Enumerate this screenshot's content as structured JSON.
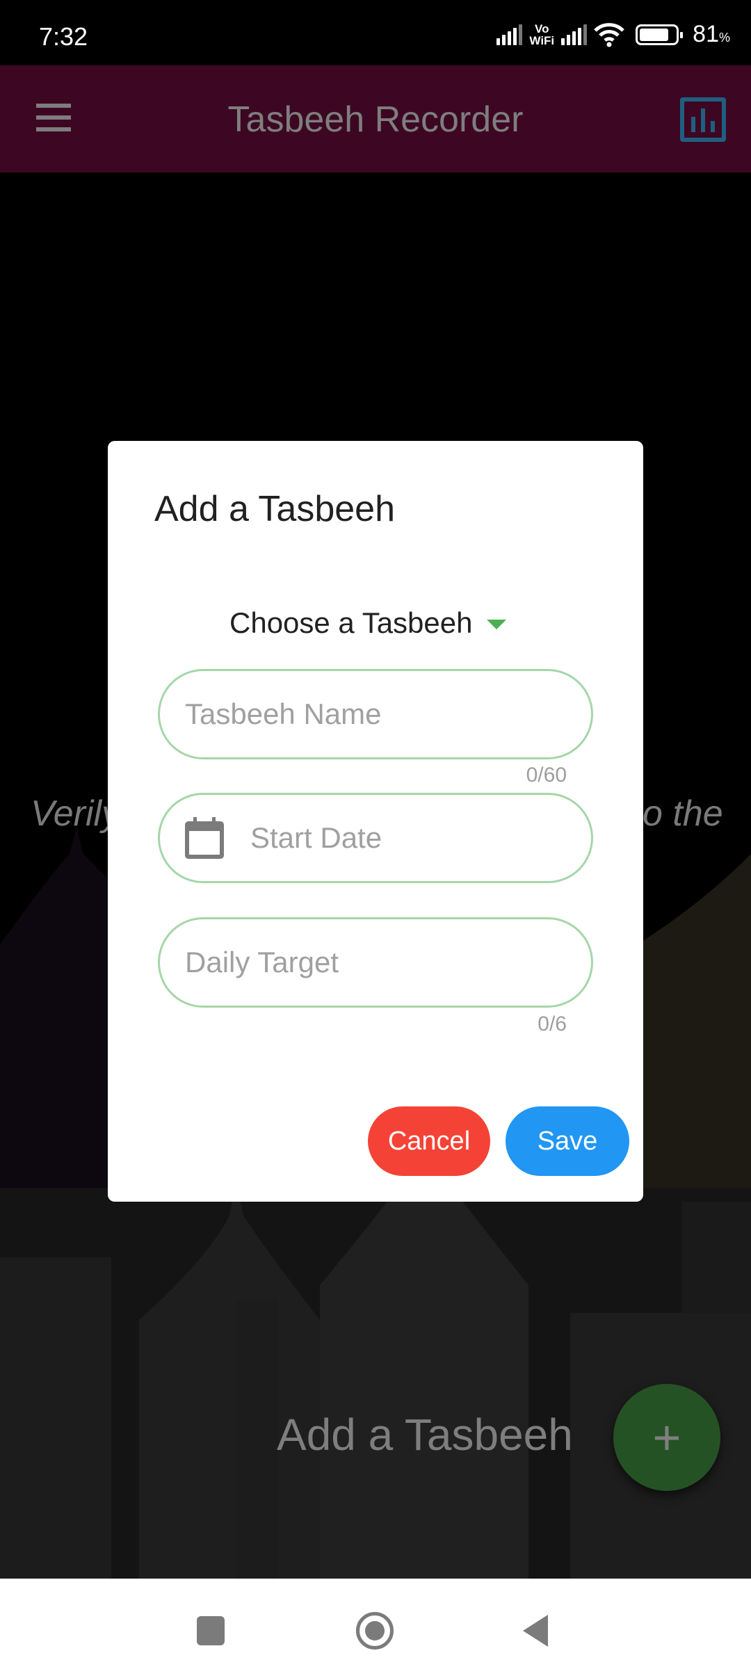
{
  "status_bar": {
    "time": "7:32",
    "vowifi_top": "Vo",
    "vowifi_bottom": "WiFi",
    "battery_percent": "81",
    "battery_percent_sign": "%",
    "battery_level": 0.81
  },
  "app_bar": {
    "title": "Tasbeeh Recorder",
    "menu_icon": "hamburger-menu-icon",
    "stats_icon": "bar-chart-icon"
  },
  "background": {
    "quote_start": "Verily",
    "quote_end": "o the",
    "add_label": "Add a Tasbeeh",
    "fab_icon": "+"
  },
  "dialog": {
    "title": "Add a Tasbeeh",
    "dropdown": {
      "label": "Choose a Tasbeeh",
      "accent_color": "#4caf50"
    },
    "fields": {
      "name": {
        "placeholder": "Tasbeeh Name",
        "value": "",
        "counter": "0/60"
      },
      "start_date": {
        "placeholder": "Start Date",
        "value": "",
        "icon": "calendar-icon"
      },
      "daily_target": {
        "placeholder": "Daily Target",
        "value": "",
        "counter": "0/6"
      }
    },
    "buttons": {
      "cancel": {
        "label": "Cancel",
        "color": "#f44336"
      },
      "save": {
        "label": "Save",
        "color": "#2196f3"
      }
    }
  },
  "nav_bar": {
    "recent": "recent-apps-icon",
    "home": "home-icon",
    "back": "back-icon"
  }
}
